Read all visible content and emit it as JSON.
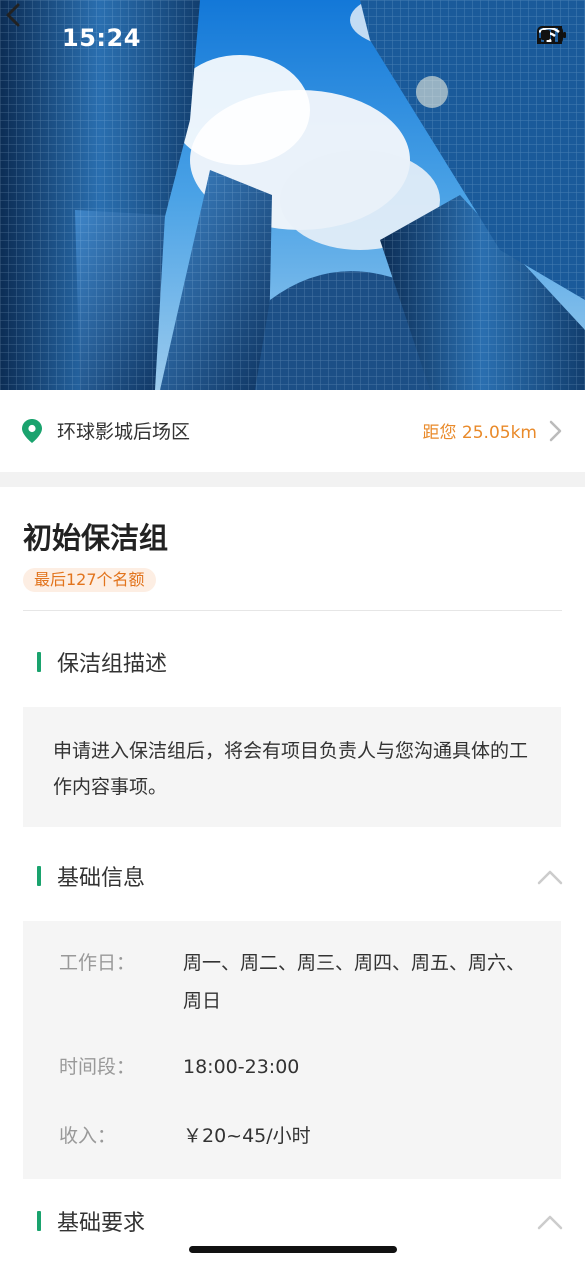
{
  "status_bar": {
    "time": "15:24"
  },
  "location": {
    "name": "环球影城后场区",
    "distance": "距您 25.05km"
  },
  "group": {
    "title": "初始保洁组",
    "quota_badge": "最后127个名额"
  },
  "sections": {
    "description": {
      "title": "保洁组描述",
      "text": "申请进入保洁组后，将会有项目负责人与您沟通具体的工作内容事项。"
    },
    "basic_info": {
      "title": "基础信息",
      "rows": [
        {
          "label": "工作日：",
          "value": "周一、周二、周三、周四、周五、周六、周日"
        },
        {
          "label": "时间段：",
          "value": "18:00-23:00"
        },
        {
          "label": "收入：",
          "value": "￥20~45/小时"
        }
      ]
    },
    "requirements": {
      "title": "基础要求"
    }
  },
  "colors": {
    "accent_green": "#1aa36e",
    "orange": "#e98a2a",
    "badge_bg": "#fdeee3"
  }
}
